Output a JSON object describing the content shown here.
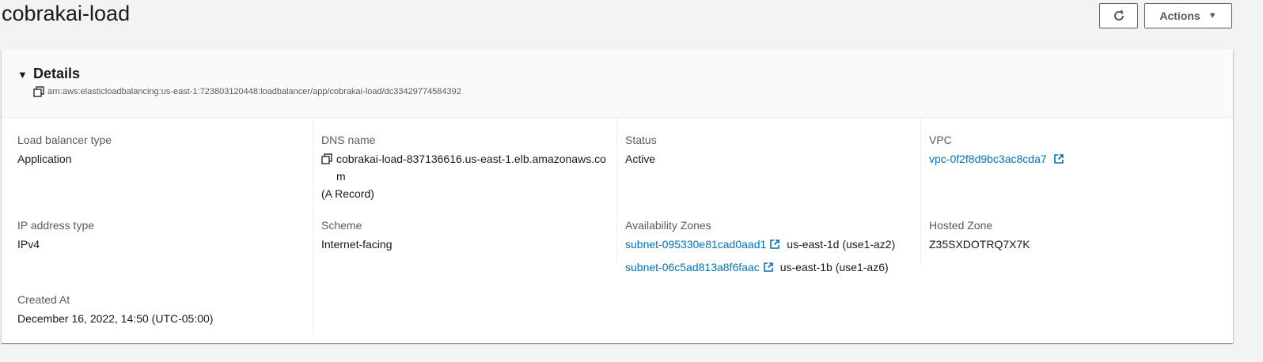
{
  "page": {
    "title": "cobrakai-load"
  },
  "toolbar": {
    "refresh_icon": "refresh-icon",
    "actions_label": "Actions",
    "actions_caret": "▼"
  },
  "details": {
    "title": "Details",
    "caret": "▼",
    "arn": "arn:aws:elasticloadbalancing:us-east-1:723803120448:loadbalancer/app/cobrakai-load/dc33429774584392"
  },
  "fields": {
    "lb_type": {
      "label": "Load balancer type",
      "value": "Application"
    },
    "ip_type": {
      "label": "IP address type",
      "value": "IPv4"
    },
    "created_at": {
      "label": "Created At",
      "value": "December 16, 2022, 14:50 (UTC-05:00)"
    },
    "dns": {
      "label": "DNS name",
      "value_line1": "cobrakai-load-837136616.us-east-1.elb.amazonaws.co",
      "value_line2": "m",
      "record": "(A Record)"
    },
    "scheme": {
      "label": "Scheme",
      "value": "Internet-facing"
    },
    "status": {
      "label": "Status",
      "value": "Active"
    },
    "azs": {
      "label": "Availability Zones",
      "items": [
        {
          "subnet": "subnet-095330e81cad0aad1",
          "zone": "us-east-1d (use1-az2)"
        },
        {
          "subnet": "subnet-06c5ad813a8f6faac",
          "zone": "us-east-1b (use1-az6)"
        }
      ]
    },
    "vpc": {
      "label": "VPC",
      "value": "vpc-0f2f8d9bc3ac8cda7"
    },
    "hosted_zone": {
      "label": "Hosted Zone",
      "value": "Z35SXDOTRQ7X7K"
    }
  },
  "colors": {
    "link": "#0073bb",
    "text": "#16191f",
    "label": "#545b64",
    "background": "#f2f3f3"
  }
}
